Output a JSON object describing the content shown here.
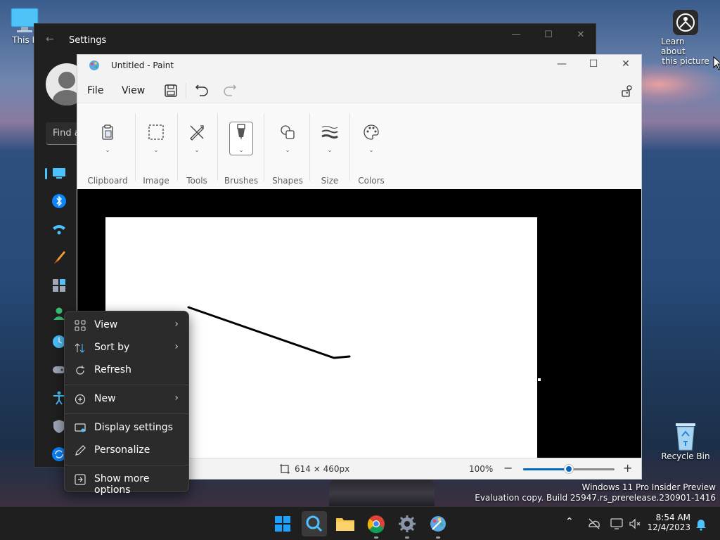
{
  "desktop": {
    "this_pc_label": "This P",
    "learn_label_line1": "Learn about",
    "learn_label_line2": "this picture",
    "recycle_bin_label": "Recycle Bin"
  },
  "settings_window": {
    "title": "Settings",
    "search_placeholder": "Find a"
  },
  "paint_window": {
    "title": "Untitled - Paint",
    "menu": {
      "file": "File",
      "view": "View"
    },
    "ribbon": {
      "clipboard": "Clipboard",
      "image": "Image",
      "tools": "Tools",
      "brushes": "Brushes",
      "shapes": "Shapes",
      "size": "Size",
      "colors": "Colors"
    },
    "status": {
      "canvas_size": "614 × 460px",
      "zoom": "100%",
      "zoom_fraction": 0.5
    }
  },
  "context_menu": {
    "items": [
      {
        "label": "View",
        "icon": "grid-icon",
        "submenu": true
      },
      {
        "label": "Sort by",
        "icon": "sort-icon",
        "submenu": true
      },
      {
        "label": "Refresh",
        "icon": "refresh-icon",
        "submenu": false
      },
      {
        "label": "New",
        "icon": "plus-circle-icon",
        "submenu": true
      },
      {
        "label": "Display settings",
        "icon": "display-settings-icon",
        "submenu": false
      },
      {
        "label": "Personalize",
        "icon": "pencil-icon",
        "submenu": false
      },
      {
        "label": "Show more options",
        "icon": "more-options-icon",
        "submenu": false
      }
    ],
    "submenu_arrow": "›"
  },
  "watermark": {
    "line1": "Windows 11 Pro Insider Preview",
    "line2": "Evaluation copy. Build 25947.rs_prerelease.230901-1416"
  },
  "taskbar": {
    "time": "8:54 AM",
    "date": "12/4/2023"
  },
  "colors": {
    "accent": "#0067c0",
    "settings_bg": "#202020",
    "menu_bg": "#2b2b2b"
  }
}
